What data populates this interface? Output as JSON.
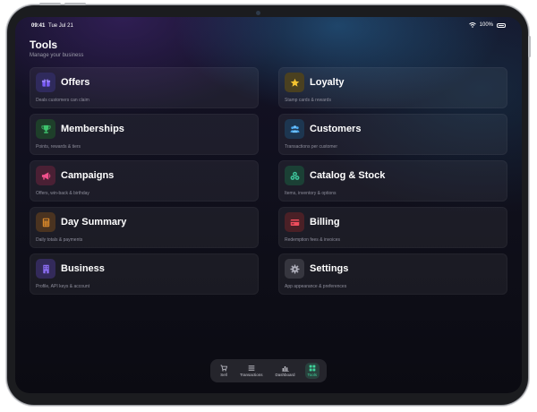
{
  "status_bar": {
    "time": "09:41",
    "date": "Tue Jul 21",
    "battery": "100%"
  },
  "header": {
    "title": "Tools",
    "subtitle": "Manage your business"
  },
  "tiles": [
    {
      "label": "Offers",
      "desc": "Deals customers can claim",
      "icon": "gift-icon",
      "color": "#7a5cf5",
      "bg": "#2f2a5c"
    },
    {
      "label": "Loyalty",
      "desc": "Stamp cards & rewards",
      "icon": "star-icon",
      "color": "#f4c430",
      "bg": "#4a4020"
    },
    {
      "label": "Memberships",
      "desc": "Points, rewards & tiers",
      "icon": "trophy-icon",
      "color": "#3ec46d",
      "bg": "#1e3f2a"
    },
    {
      "label": "Customers",
      "desc": "Transactions per customer",
      "icon": "people-icon",
      "color": "#4aa8f0",
      "bg": "#1d3650"
    },
    {
      "label": "Campaigns",
      "desc": "Offers, win-back & birthday",
      "icon": "megaphone-icon",
      "color": "#f0508c",
      "bg": "#4a2034"
    },
    {
      "label": "Catalog & Stock",
      "desc": "Items, inventory & options",
      "icon": "boxes-icon",
      "color": "#3ec49b",
      "bg": "#1b4035"
    },
    {
      "label": "Day Summary",
      "desc": "Daily totals & payments",
      "icon": "calculator-icon",
      "color": "#f0962c",
      "bg": "#4a3320"
    },
    {
      "label": "Billing",
      "desc": "Redemption fees & invoices",
      "icon": "card-icon",
      "color": "#f04d5c",
      "bg": "#4a2026"
    },
    {
      "label": "Business",
      "desc": "Profile, API keys & account",
      "icon": "building-icon",
      "color": "#8a6cf0",
      "bg": "#332a5a"
    },
    {
      "label": "Settings",
      "desc": "App appearance & preferences",
      "icon": "gear-icon",
      "color": "#b0b0bc",
      "bg": "#36363f"
    }
  ],
  "tabbar": {
    "tabs": [
      {
        "label": "Sell",
        "icon": "cart-icon"
      },
      {
        "label": "Transactions",
        "icon": "list-icon"
      },
      {
        "label": "Dashboard",
        "icon": "chart-icon"
      },
      {
        "label": "Tools",
        "icon": "grid-icon"
      }
    ],
    "active": "Tools",
    "active_color": "#3fd49b"
  }
}
